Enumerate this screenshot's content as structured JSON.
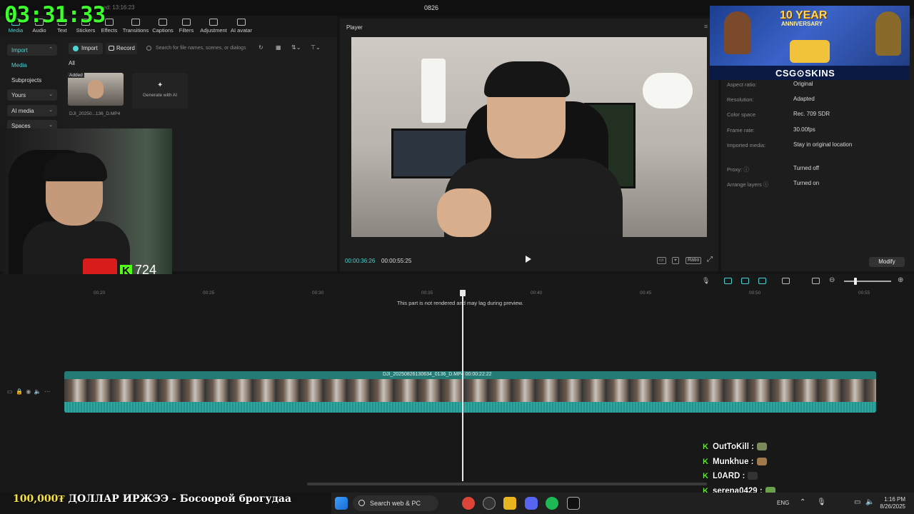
{
  "overlay": {
    "clock": "03:31:33",
    "viewer_count": "724",
    "ticker_amount": "100,000₮",
    "ticker_text": " ДОЛЛАР ИРЖЭЭ - Босоорой брогудаа"
  },
  "app": {
    "title": "0826",
    "saved": "ed: 13:16:23"
  },
  "toolbar": {
    "items": [
      "Media",
      "Audio",
      "Text",
      "Stickers",
      "Effects",
      "Transitions",
      "Captions",
      "Filters",
      "Adjustment",
      "AI avatar"
    ],
    "active": "Media"
  },
  "leftnav": {
    "items": [
      {
        "label": "Import"
      },
      {
        "label": "Media"
      },
      {
        "label": "Subprojects"
      },
      {
        "label": "Yours"
      },
      {
        "label": "AI media"
      },
      {
        "label": "Spaces"
      }
    ]
  },
  "media": {
    "import_label": "Import",
    "record_label": "Record",
    "search_placeholder": "Search for file names, scenes, or dialogs",
    "filter_all": "All",
    "clip_badge": "Added",
    "clip_name": "DJI_20250...136_D.MP4",
    "generate_label": "Generate with AI"
  },
  "player": {
    "title": "Player",
    "current_time": "00:00:36:26",
    "total_time": "00:00:55:25",
    "ratio_label": "Ratio"
  },
  "details": {
    "rows": [
      {
        "label": "Aspect ratio:",
        "value": "Original"
      },
      {
        "label": "Resolution:",
        "value": "Adapted"
      },
      {
        "label": "Color space",
        "value": "Rec. 709 SDR"
      },
      {
        "label": "Frame rate:",
        "value": "30.00fps"
      },
      {
        "label": "Imported media:",
        "value": "Stay in original location"
      },
      {
        "label": "Proxy: ⓘ",
        "value": "Turned off"
      },
      {
        "label": "Arrange layers ⓘ",
        "value": "Turned on"
      }
    ],
    "modify_label": "Modify"
  },
  "ad": {
    "title": "10 YEAR",
    "subtitle": "ANNIVERSARY",
    "brand": "CSG⊙SKINS"
  },
  "timeline": {
    "ticks": [
      "00:20",
      "00:25",
      "00:30",
      "00:35",
      "00:40",
      "00:45",
      "00:50",
      "00:55"
    ],
    "render_warning": "This part is not rendered and may lag during preview.",
    "clip_label": "DJI_20250826130634_0136_D.MP4   00:00:22:22"
  },
  "chat": [
    {
      "user": "OutToKill",
      "sep": " :"
    },
    {
      "user": "Munkhue",
      "sep": " :"
    },
    {
      "user": "L0ARD",
      "sep": " :"
    },
    {
      "user": "serena0429",
      "sep": " :"
    }
  ],
  "taskbar": {
    "search_label": "Search web & PC",
    "lang": "ENG",
    "time": "1:16 PM",
    "date": "8/26/2025"
  },
  "colors": {
    "accent": "#4fd2d2",
    "clock": "#3dff2e",
    "kick": "#53fc18",
    "track": "#1f6f6a"
  }
}
